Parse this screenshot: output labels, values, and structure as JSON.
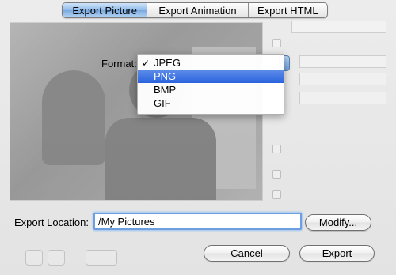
{
  "tabs": [
    {
      "label": "Export Picture",
      "active": true
    },
    {
      "label": "Export Animation",
      "active": false
    },
    {
      "label": "Export HTML",
      "active": false
    }
  ],
  "format": {
    "label": "Format:",
    "options": [
      {
        "label": "JPEG",
        "checked": true,
        "highlighted": false
      },
      {
        "label": "PNG",
        "checked": false,
        "highlighted": true
      },
      {
        "label": "BMP",
        "checked": false,
        "highlighted": false
      },
      {
        "label": "GIF",
        "checked": false,
        "highlighted": false
      }
    ],
    "check_mark": "✓"
  },
  "export_location": {
    "label": "Export Location:",
    "value": "/My Pictures",
    "modify_label": "Modify..."
  },
  "actions": {
    "cancel_label": "Cancel",
    "export_label": "Export"
  },
  "colors": {
    "accent": "#2a63de",
    "focus_ring": "#6d9fe0"
  }
}
